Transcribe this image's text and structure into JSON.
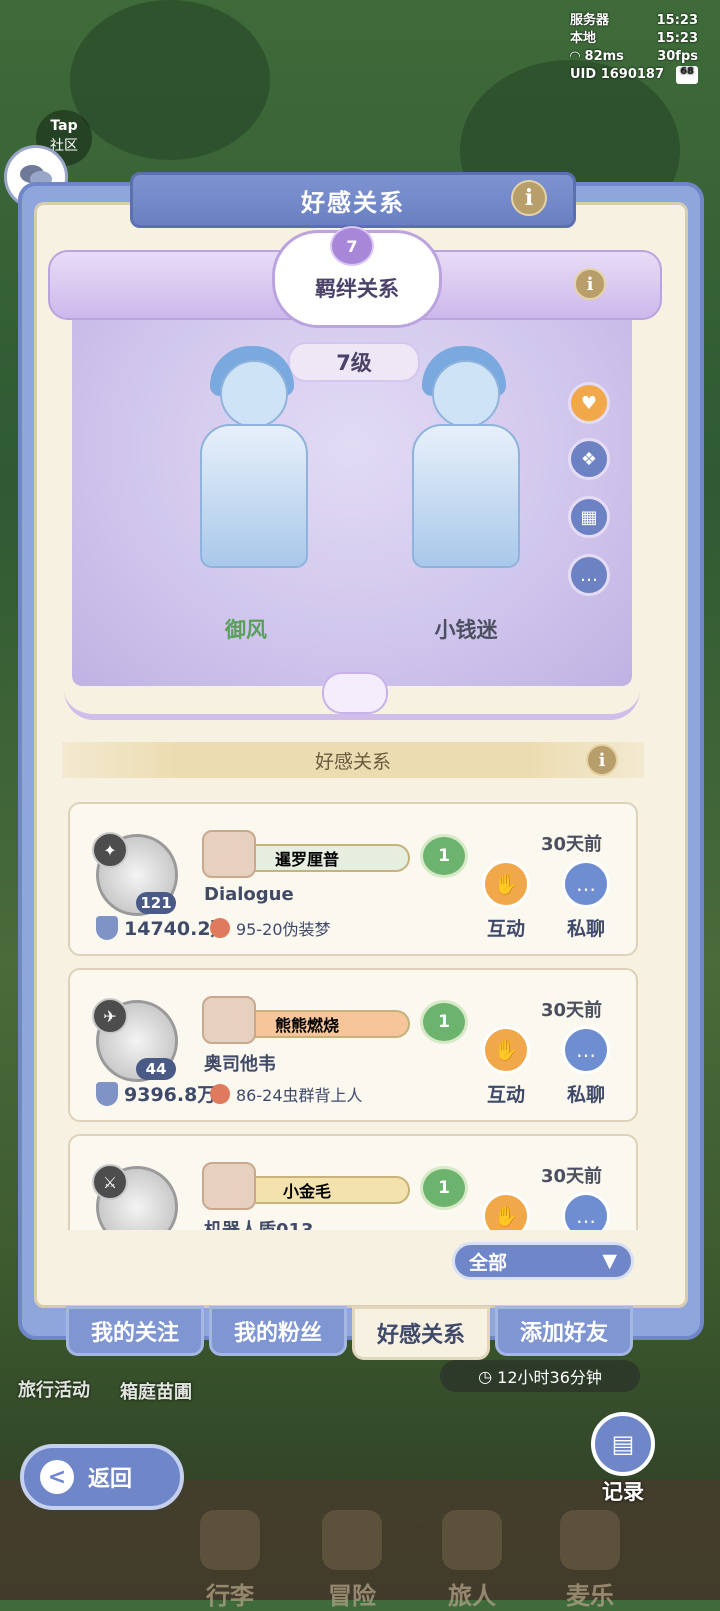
{
  "status": {
    "server_label": "服务器",
    "server_time": "15:23",
    "local_label": "本地",
    "local_time": "15:23",
    "ping": "82ms",
    "fps": "30fps",
    "uid": "UID 1690187",
    "battery": "68"
  },
  "tap": {
    "brand": "Tap",
    "label": "社区"
  },
  "panel": {
    "title": "好感关系"
  },
  "bond": {
    "title": "羁绊关系",
    "heart_level": "7",
    "level": "7级",
    "left_name": "御风",
    "right_name": "小钱迷",
    "left_name_color": "#5aa05c",
    "right_name_color": "#4b4f60"
  },
  "section": {
    "title": "好感关系"
  },
  "friends": [
    {
      "avatar_level": "121",
      "title": "暹罗厘普",
      "name": "Dialogue",
      "score": "14740.2万",
      "location": "95-20伪装梦",
      "heart_level": "1",
      "time": "30天前",
      "interact_label": "互动",
      "chat_label": "私聊",
      "plate_color": "#e6eee0"
    },
    {
      "avatar_level": "44",
      "title": "熊熊燃烧",
      "name": "奥司他韦",
      "score": "9396.8万",
      "location": "86-24虫群背上人",
      "heart_level": "1",
      "time": "30天前",
      "interact_label": "互动",
      "chat_label": "私聊",
      "plate_color": "#f6c59a"
    },
    {
      "avatar_level": "",
      "title": "小金毛",
      "name": "机器人盾013",
      "score": "",
      "location": "",
      "heart_level": "1",
      "time": "30天前",
      "interact_label": "互动",
      "chat_label": "私聊",
      "plate_color": "#f3e2ad"
    }
  ],
  "filter": {
    "selected": "全部",
    "arrow": "▼"
  },
  "tabs": [
    {
      "label": "我的关注",
      "active": false
    },
    {
      "label": "我的粉丝",
      "active": false
    },
    {
      "label": "好感关系",
      "active": true
    },
    {
      "label": "添加好友",
      "active": false
    }
  ],
  "background": {
    "travel_label": "旅行活动",
    "garden_label": "箱庭苗圃",
    "timer": "12小时36分钟",
    "bottom_items": [
      "行李",
      "冒险",
      "旅人",
      "麦乐"
    ]
  },
  "back": {
    "label": "返回",
    "arrow": "<"
  },
  "record": {
    "label": "记录"
  }
}
